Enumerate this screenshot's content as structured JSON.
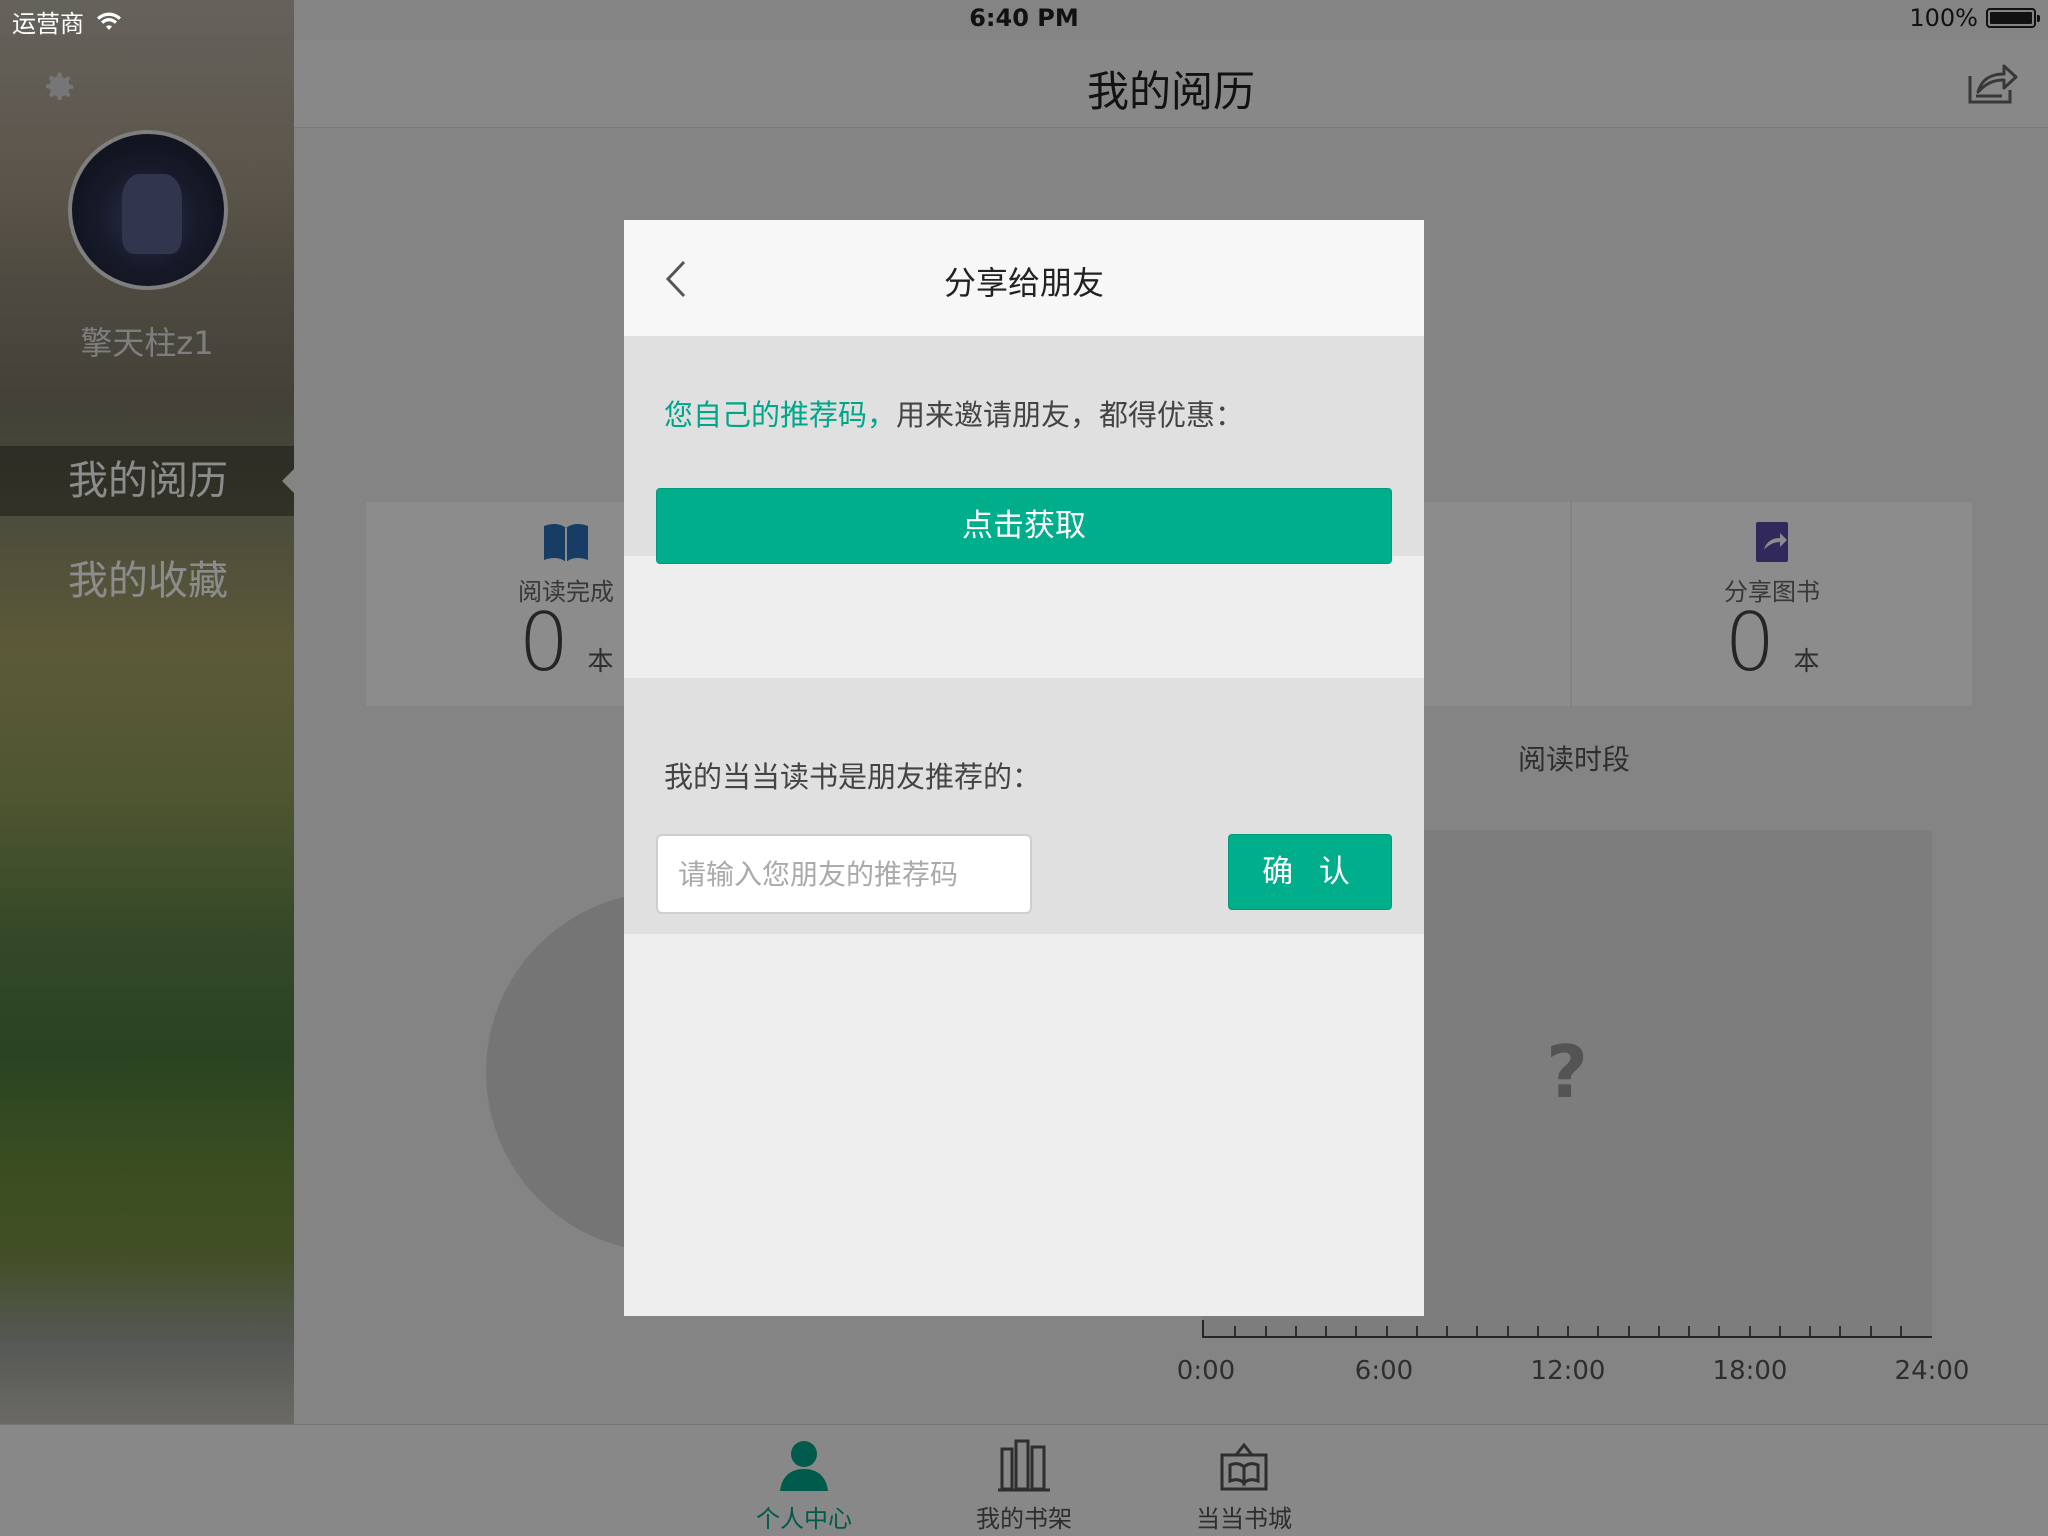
{
  "status_bar": {
    "carrier": "运营商",
    "time": "6:40 PM",
    "battery": "100%"
  },
  "sidebar": {
    "username": "擎天柱z1",
    "items": [
      {
        "label": "我的阅历",
        "active": true
      },
      {
        "label": "我的收藏",
        "active": false
      }
    ]
  },
  "header": {
    "title": "我的阅历"
  },
  "stats": [
    {
      "label": "阅读完成",
      "value": "0",
      "unit": "本",
      "icon": "book-open-icon"
    },
    {
      "label": "分享图书",
      "value": "0",
      "unit": "本",
      "icon": "share-book-icon"
    }
  ],
  "sections": {
    "reading_period": "阅读时段"
  },
  "chart": {
    "placeholder": "?",
    "x_labels": [
      "0:00",
      "6:00",
      "12:00",
      "18:00",
      "24:00"
    ]
  },
  "tabs": [
    {
      "label": "个人中心",
      "icon": "person-icon",
      "active": true
    },
    {
      "label": "我的书架",
      "icon": "bookshelf-icon",
      "active": false
    },
    {
      "label": "当当书城",
      "icon": "bookstore-icon",
      "active": false
    }
  ],
  "modal": {
    "title": "分享给朋友",
    "invite_highlight": "您自己的推荐码，",
    "invite_rest": "用来邀请朋友，都得优惠：",
    "get_button": "点击获取",
    "referral_label": "我的当当读书是朋友推荐的：",
    "referral_placeholder": "请输入您朋友的推荐码",
    "confirm_button": "确 认"
  },
  "colors": {
    "accent": "#00ae8c",
    "accent_text": "#00a68a",
    "overlay": "rgba(0,0,0,0.45)"
  }
}
